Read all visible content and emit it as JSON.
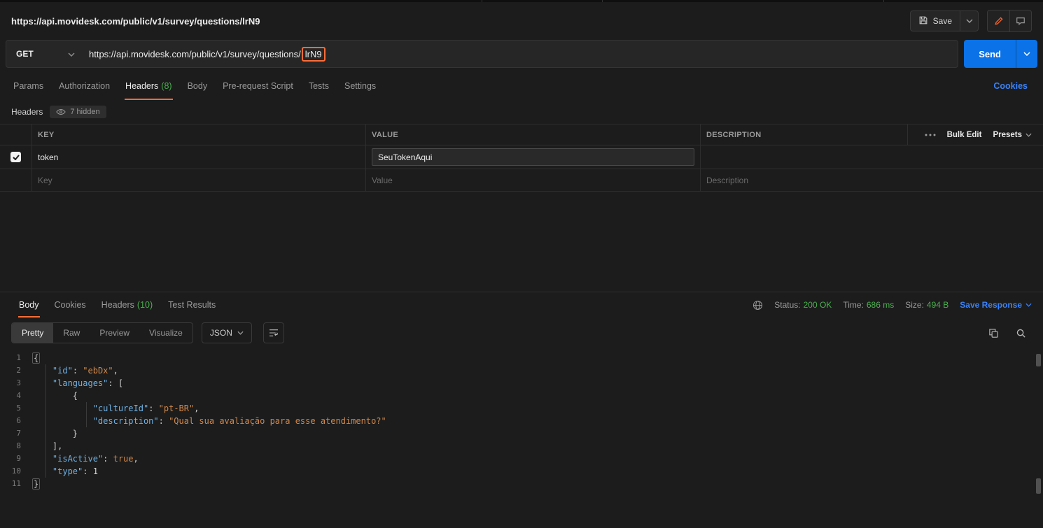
{
  "colors": {
    "accent_orange": "#ff6c37",
    "success_green": "#4caf50",
    "link_blue": "#3b82f6",
    "send_blue": "#0b72e7",
    "json_key": "#71b1e3",
    "json_string": "#d0874a"
  },
  "topbar": {
    "title": "https://api.movidesk.com/public/v1/survey/questions/lrN9",
    "save_label": "Save"
  },
  "request": {
    "method": "GET",
    "url_prefix": "https://api.movidesk.com/public/v1/survey/questions/",
    "url_highlight": "lrN9",
    "send_label": "Send",
    "cookies_label": "Cookies",
    "tabs": {
      "params": "Params",
      "authorization": "Authorization",
      "headers_label": "Headers",
      "headers_count": "(8)",
      "body": "Body",
      "prerequest": "Pre-request Script",
      "tests": "Tests",
      "settings": "Settings"
    }
  },
  "headers_panel": {
    "title": "Headers",
    "hidden_badge": "7 hidden",
    "col_key": "KEY",
    "col_value": "VALUE",
    "col_description": "DESCRIPTION",
    "bulk_edit_label": "Bulk Edit",
    "presets_label": "Presets",
    "row": {
      "key": "token",
      "value": "SeuTokenAqui",
      "description": ""
    },
    "placeholder": {
      "key": "Key",
      "value": "Value",
      "description": "Description"
    }
  },
  "response": {
    "tabs": {
      "body": "Body",
      "cookies": "Cookies",
      "headers_label": "Headers",
      "headers_count": "(10)",
      "test_results": "Test Results"
    },
    "meta": {
      "status_label": "Status:",
      "status_value": "200 OK",
      "time_label": "Time:",
      "time_value": "686 ms",
      "size_label": "Size:",
      "size_value": "494 B",
      "save_response_label": "Save Response"
    },
    "viewbar": {
      "pretty": "Pretty",
      "raw": "Raw",
      "preview": "Preview",
      "visualize": "Visualize",
      "format": "JSON"
    },
    "code": {
      "lines": [
        [
          [
            "m",
            "{"
          ]
        ],
        [
          [
            "p",
            "    "
          ],
          [
            "k",
            "\"id\""
          ],
          [
            "p",
            ": "
          ],
          [
            "s",
            "\"ebDx\""
          ],
          [
            "p",
            ","
          ]
        ],
        [
          [
            "p",
            "    "
          ],
          [
            "k",
            "\"languages\""
          ],
          [
            "p",
            ": ["
          ]
        ],
        [
          [
            "p",
            "        {"
          ]
        ],
        [
          [
            "p",
            "            "
          ],
          [
            "k",
            "\"cultureId\""
          ],
          [
            "p",
            ": "
          ],
          [
            "s",
            "\"pt-BR\""
          ],
          [
            "p",
            ","
          ]
        ],
        [
          [
            "p",
            "            "
          ],
          [
            "k",
            "\"description\""
          ],
          [
            "p",
            ": "
          ],
          [
            "s",
            "\"Qual sua avaliação para esse atendimento?\""
          ]
        ],
        [
          [
            "p",
            "        }"
          ]
        ],
        [
          [
            "p",
            "    ],"
          ]
        ],
        [
          [
            "p",
            "    "
          ],
          [
            "k",
            "\"isActive\""
          ],
          [
            "p",
            ": "
          ],
          [
            "b",
            "true"
          ],
          [
            "p",
            ","
          ]
        ],
        [
          [
            "p",
            "    "
          ],
          [
            "k",
            "\"type\""
          ],
          [
            "p",
            ": "
          ],
          [
            "n",
            "1"
          ]
        ],
        [
          [
            "m",
            "}"
          ]
        ]
      ]
    }
  }
}
